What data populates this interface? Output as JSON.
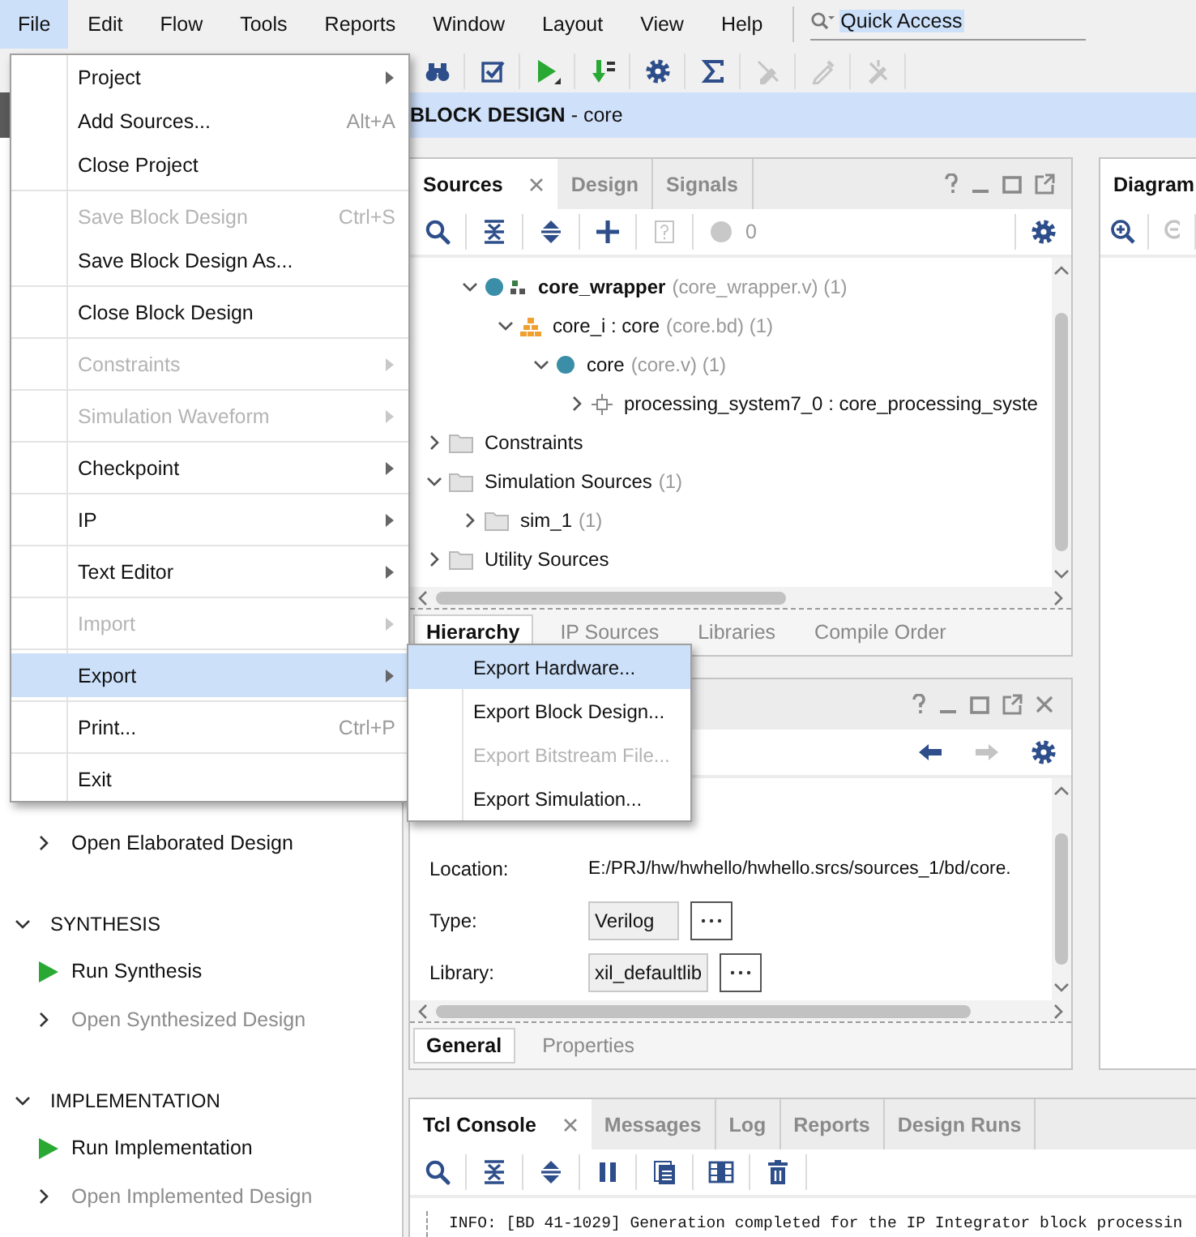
{
  "menubar": {
    "items": [
      {
        "label": "File",
        "selected": true
      },
      {
        "label": "Edit",
        "selected": false
      },
      {
        "label": "Flow",
        "selected": false
      },
      {
        "label": "Tools",
        "selected": false
      },
      {
        "label": "Reports",
        "selected": false
      },
      {
        "label": "Window",
        "selected": false
      },
      {
        "label": "Layout",
        "selected": false
      },
      {
        "label": "View",
        "selected": false
      },
      {
        "label": "Help",
        "selected": false
      }
    ]
  },
  "quick_access": {
    "value": "Quick Access"
  },
  "toolbar": [
    {
      "kind": "binoculars",
      "disabled": false
    },
    {
      "kind": "checklist",
      "disabled": false
    },
    {
      "kind": "run",
      "disabled": false
    },
    {
      "kind": "bitstream",
      "disabled": false
    },
    {
      "kind": "settings",
      "disabled": false
    },
    {
      "kind": "sigma",
      "disabled": false
    },
    {
      "kind": "probe",
      "disabled": true
    },
    {
      "kind": "link",
      "disabled": true
    },
    {
      "kind": "unlink",
      "disabled": true
    }
  ],
  "context_header": "**BLOCK DESIGN** - core",
  "flow_navigator": {
    "sections": [
      {
        "items": [
          {
            "label": "Open Elaborated Design",
            "kind": "open",
            "disabled": false
          }
        ]
      },
      {
        "title": "SYNTHESIS",
        "expanded": true,
        "items": [
          {
            "label": "Run Synthesis",
            "kind": "run",
            "disabled": false
          },
          {
            "label": "Open Synthesized Design",
            "kind": "open",
            "disabled": true
          }
        ]
      },
      {
        "title": "IMPLEMENTATION",
        "expanded": true,
        "items": [
          {
            "label": "Run Implementation",
            "kind": "run",
            "disabled": false
          },
          {
            "label": "Open Implemented Design",
            "kind": "open",
            "disabled": true
          }
        ]
      }
    ]
  },
  "sources_panel": {
    "tabs": [
      {
        "label": "Sources",
        "selected": true,
        "closable": true
      },
      {
        "label": "Design",
        "selected": false,
        "closable": false
      },
      {
        "label": "Signals",
        "selected": false,
        "closable": false
      }
    ],
    "toolbar": [
      {
        "kind": "search",
        "disabled": false
      },
      {
        "kind": "collapse",
        "disabled": false
      },
      {
        "kind": "expand",
        "disabled": false
      },
      {
        "kind": "add",
        "disabled": false
      },
      {
        "kind": "doc_help",
        "disabled": true
      }
    ],
    "message_count": "0",
    "tree": {
      "partial_rows": [
        {
          "name": "core_wrapper",
          "detail": "(core_wrapper.v) (1)",
          "kind": "wrapper",
          "bold": true,
          "expanded": true,
          "children": [
            {
              "name": "core_i : core",
              "detail": "(core.bd) (1)",
              "kind": "bd",
              "bold": false,
              "expanded": true,
              "children": [
                {
                  "name": "core",
                  "detail": "(core.v) (1)",
                  "kind": "module",
                  "bold": false,
                  "expanded": true,
                  "children": [
                    {
                      "name": "processing_system7_0 : core_processing_syste",
                      "kind": "ip",
                      "bold": false,
                      "expanded": false
                    }
                  ]
                }
              ]
            }
          ]
        }
      ],
      "rows": [
        {
          "name": "Constraints",
          "kind": "folder",
          "bold": false,
          "expanded": false
        },
        {
          "name": "Simulation Sources",
          "detail": "(1)",
          "kind": "folder",
          "bold": false,
          "expanded": true,
          "children": [
            {
              "name": "sim_1",
              "detail": "(1)",
              "kind": "folder",
              "bold": false,
              "expanded": false
            }
          ]
        },
        {
          "name": "Utility Sources",
          "kind": "folder",
          "bold": false,
          "expanded": false
        }
      ]
    },
    "bottom_tabs": [
      {
        "label": "Hierarchy",
        "selected": true
      },
      {
        "label": "IP Sources",
        "selected": false
      },
      {
        "label": "Libraries",
        "selected": false
      },
      {
        "label": "Compile Order",
        "selected": false
      }
    ]
  },
  "properties_panel": {
    "toolbar": [
      {
        "kind": "back",
        "disabled": false
      },
      {
        "kind": "forward",
        "disabled": true
      },
      {
        "kind": "settings",
        "disabled": false
      }
    ],
    "fields": [
      {
        "label": "Location:",
        "value": "E:/PRJ/hw/hwhello/hwhello.srcs/sources_1/bd/core.",
        "kind": "text"
      },
      {
        "label": "Type:",
        "value": "Verilog",
        "kind": "choice"
      },
      {
        "label": "Library:",
        "value": "xil_defaultlib",
        "kind": "choice"
      }
    ],
    "bottom_tabs": [
      {
        "label": "General",
        "selected": true
      },
      {
        "label": "Properties",
        "selected": false
      }
    ]
  },
  "diagram_panel": {
    "tabs": [
      {
        "label": "Diagram",
        "selected": true
      }
    ],
    "toolbar": [
      {
        "kind": "zoom_in",
        "disabled": false
      },
      {
        "kind": "zoom_out_part",
        "disabled": true
      }
    ]
  },
  "console_panel": {
    "tabs": [
      {
        "label": "Tcl Console",
        "selected": true,
        "closable": true
      },
      {
        "label": "Messages",
        "selected": false,
        "closable": false
      },
      {
        "label": "Log",
        "selected": false,
        "closable": false
      },
      {
        "label": "Reports",
        "selected": false,
        "closable": false
      },
      {
        "label": "Design Runs",
        "selected": false,
        "closable": false
      }
    ],
    "toolbar": [
      {
        "kind": "search",
        "disabled": false
      },
      {
        "kind": "collapse",
        "disabled": false
      },
      {
        "kind": "expand",
        "disabled": false
      },
      {
        "kind": "pause",
        "disabled": false
      },
      {
        "kind": "copy",
        "disabled": false
      },
      {
        "kind": "columns",
        "disabled": false
      },
      {
        "kind": "trash",
        "disabled": false
      }
    ],
    "lines": [
      "INFO: [BD 41-1029] Generation completed for the IP Integrator block processin"
    ]
  },
  "file_menu": {
    "groups": [
      [
        {
          "label": "Project",
          "has_submenu": true,
          "disabled": false,
          "selected": false
        },
        {
          "label": "Add Sources...",
          "shortcut": "Alt+A",
          "has_submenu": false,
          "disabled": false,
          "selected": false
        },
        {
          "label": "Close Project",
          "has_submenu": false,
          "disabled": false,
          "selected": false
        }
      ],
      [
        {
          "label": "Save Block Design",
          "shortcut": "Ctrl+S",
          "has_submenu": false,
          "disabled": true,
          "selected": false
        },
        {
          "label": "Save Block Design As...",
          "has_submenu": false,
          "disabled": false,
          "selected": false
        }
      ],
      [
        {
          "label": "Close Block Design",
          "has_submenu": false,
          "disabled": false,
          "selected": false
        }
      ],
      [
        {
          "label": "Constraints",
          "has_submenu": true,
          "disabled": true,
          "selected": false
        }
      ],
      [
        {
          "label": "Simulation Waveform",
          "has_submenu": true,
          "disabled": true,
          "selected": false
        }
      ],
      [
        {
          "label": "Checkpoint",
          "has_submenu": true,
          "disabled": false,
          "selected": false
        }
      ],
      [
        {
          "label": "IP",
          "has_submenu": true,
          "disabled": false,
          "selected": false
        }
      ],
      [
        {
          "label": "Text Editor",
          "has_submenu": true,
          "disabled": false,
          "selected": false
        }
      ],
      [
        {
          "label": "Import",
          "has_submenu": true,
          "disabled": true,
          "selected": false
        }
      ],
      [
        {
          "label": "Export",
          "has_submenu": true,
          "disabled": false,
          "selected": true
        }
      ],
      [
        {
          "label": "Print...",
          "shortcut": "Ctrl+P",
          "has_submenu": false,
          "disabled": false,
          "selected": false
        }
      ],
      [
        {
          "label": "Exit",
          "has_submenu": false,
          "disabled": false,
          "selected": false
        }
      ]
    ]
  },
  "export_submenu": {
    "items": [
      {
        "label": "Export Hardware...",
        "disabled": false,
        "selected": true
      },
      {
        "label": "Export Block Design...",
        "disabled": false,
        "selected": false
      },
      {
        "label": "Export Bitstream File...",
        "disabled": true,
        "selected": false
      },
      {
        "label": "Export Simulation...",
        "disabled": false,
        "selected": false
      }
    ]
  }
}
